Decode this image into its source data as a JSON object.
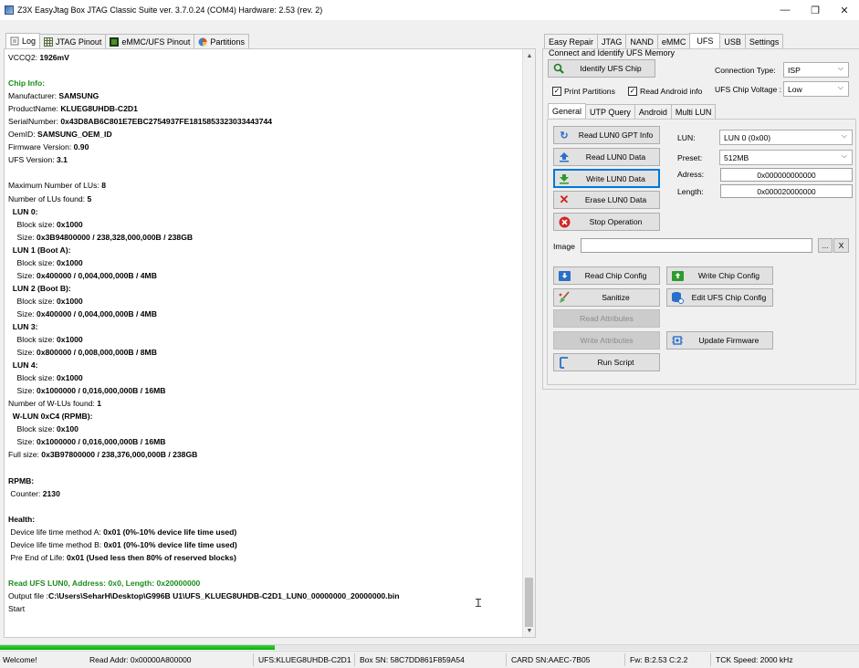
{
  "window": {
    "title": "Z3X EasyJtag Box JTAG Classic Suite ver. 3.7.0.24 (COM4) Hardware: 2.53 (rev. 2)",
    "minimize_glyph": "—",
    "maximize_glyph": "❐",
    "close_glyph": "✕"
  },
  "left_tabs": [
    {
      "label": "Log",
      "icon": "log-icon"
    },
    {
      "label": "JTAG Pinout",
      "icon": "grid-icon"
    },
    {
      "label": "eMMC/UFS Pinout",
      "icon": "chip-icon"
    },
    {
      "label": "Partitions",
      "icon": "pie-icon"
    }
  ],
  "log": [
    {
      "text": "VCCQ2: ",
      "value": "1926mV"
    },
    {
      "text": "",
      "value": ""
    },
    {
      "text": "Chip Info:",
      "value": "",
      "style": "green"
    },
    {
      "text": "Manufacturer: ",
      "value": "SAMSUNG"
    },
    {
      "text": "ProductName: ",
      "value": "KLUEG8UHDB-C2D1"
    },
    {
      "text": "SerialNumber: ",
      "value": "0x43D8AB6C801E7EBC2754937FE1815853323033443744"
    },
    {
      "text": "OemID: ",
      "value": "SAMSUNG_OEM_ID"
    },
    {
      "text": "Firmware Version: ",
      "value": "0.90"
    },
    {
      "text": "UFS Version: ",
      "value": "3.1"
    },
    {
      "text": "",
      "value": ""
    },
    {
      "text": "Maximum Number of LUs: ",
      "value": "8"
    },
    {
      "text": "Number of LUs found: ",
      "value": "5"
    },
    {
      "text": "  ",
      "value": "LUN 0:"
    },
    {
      "text": "    Block size: ",
      "value": "0x1000"
    },
    {
      "text": "    Size: ",
      "value": "0x3B94800000 / 238,328,000,000B / 238GB"
    },
    {
      "text": "  ",
      "value": "LUN 1 (Boot A):"
    },
    {
      "text": "    Block size: ",
      "value": "0x1000"
    },
    {
      "text": "    Size: ",
      "value": "0x400000 / 0,004,000,000B / 4MB"
    },
    {
      "text": "  ",
      "value": "LUN 2 (Boot B):"
    },
    {
      "text": "    Block size: ",
      "value": "0x1000"
    },
    {
      "text": "    Size: ",
      "value": "0x400000 / 0,004,000,000B / 4MB"
    },
    {
      "text": "  ",
      "value": "LUN 3:"
    },
    {
      "text": "    Block size: ",
      "value": "0x1000"
    },
    {
      "text": "    Size: ",
      "value": "0x800000 / 0,008,000,000B / 8MB"
    },
    {
      "text": "  ",
      "value": "LUN 4:"
    },
    {
      "text": "    Block size: ",
      "value": "0x1000"
    },
    {
      "text": "    Size: ",
      "value": "0x1000000 / 0,016,000,000B / 16MB"
    },
    {
      "text": "Number of W-LUs found: ",
      "value": "1"
    },
    {
      "text": "  ",
      "value": "W-LUN 0xC4 (RPMB):"
    },
    {
      "text": "    Block size: ",
      "value": "0x100"
    },
    {
      "text": "    Size: ",
      "value": "0x1000000 / 0,016,000,000B / 16MB"
    },
    {
      "text": "Full size: ",
      "value": "0x3B97800000 / 238,376,000,000B / 238GB"
    },
    {
      "text": "",
      "value": ""
    },
    {
      "text": "",
      "value": "RPMB:"
    },
    {
      "text": " Counter: ",
      "value": "2130"
    },
    {
      "text": "",
      "value": ""
    },
    {
      "text": "",
      "value": "Health:"
    },
    {
      "text": " Device life time method A: ",
      "value": "0x01 (0%-10% device life time used)"
    },
    {
      "text": " Device life time method B: ",
      "value": "0x01 (0%-10% device life time used)"
    },
    {
      "text": " Pre End of Life: ",
      "value": "0x01 (Used less then 80% of reserved blocks)"
    },
    {
      "text": "",
      "value": ""
    },
    {
      "text": "",
      "value": "Read UFS LUN0, Address: 0x0, Length: 0x20000000",
      "style": "green"
    },
    {
      "text": "Output file :",
      "value": "C:\\Users\\SeharH\\Desktop\\G996B U1\\UFS_KLUEG8UHDB-C2D1_LUN0_00000000_20000000.bin"
    },
    {
      "text": "Start",
      "value": ""
    }
  ],
  "right_tabs": [
    "Easy Repair",
    "JTAG",
    "NAND",
    "eMMC",
    "UFS",
    "USB",
    "Settings"
  ],
  "connect_group": {
    "title": "Connect and Identify UFS Memory",
    "identify_button": "Identify UFS Chip",
    "connection_type_label": "Connection Type:",
    "connection_type_value": "ISP",
    "voltage_label": "UFS Chip Voltage :",
    "voltage_value": "Low",
    "print_partitions_label": "Print Partitions",
    "print_partitions_checked": true,
    "read_android_info_label": "Read Android info",
    "read_android_info_checked": true
  },
  "sub_tabs": [
    "General",
    "UTP Query",
    "Android",
    "Multi LUN"
  ],
  "actions": {
    "read_gpt": "Read LUN0 GPT Info",
    "read_data": "Read LUN0 Data",
    "write_data": "Write LUN0 Data",
    "erase_data": "Erase LUN0 Data",
    "stop": "Stop Operation",
    "read_chip_config": "Read Chip Config",
    "write_chip_config": "Write Chip Config",
    "sanitize": "Sanitize",
    "edit_ufs_config": "Edit UFS Chip Config",
    "read_attributes": "Read Attributes",
    "write_attributes": "Write Attributes",
    "update_firmware": "Update Firmware",
    "run_script": "Run Script"
  },
  "params": {
    "lun_label": "LUN:",
    "lun_value": "LUN 0 (0x00)",
    "preset_label": "Preset:",
    "preset_value": "512MB",
    "address_label": "Adress:",
    "address_value": "0x000000000000",
    "length_label": "Length:",
    "length_value": "0x000020000000"
  },
  "image_row": {
    "label": "Image",
    "value": "",
    "browse": "...",
    "clear": "X"
  },
  "progress": 0.32,
  "status": {
    "message": "Welcome!",
    "read_addr": "Read Addr: 0x00000A800000",
    "ufs": "UFS:KLUEG8UHDB-C2D1",
    "box_sn": "Box SN: 58C7DD861F859A54",
    "card_sn": "CARD SN:AAEC-7B05",
    "fw": "Fw: B:2.53 C:2.2",
    "tck": "TCK Speed: 2000 kHz"
  },
  "colors": {
    "green_text": "#1a8c1a",
    "progress_fill": "#06b006",
    "default_button_border": "#0078d7"
  }
}
